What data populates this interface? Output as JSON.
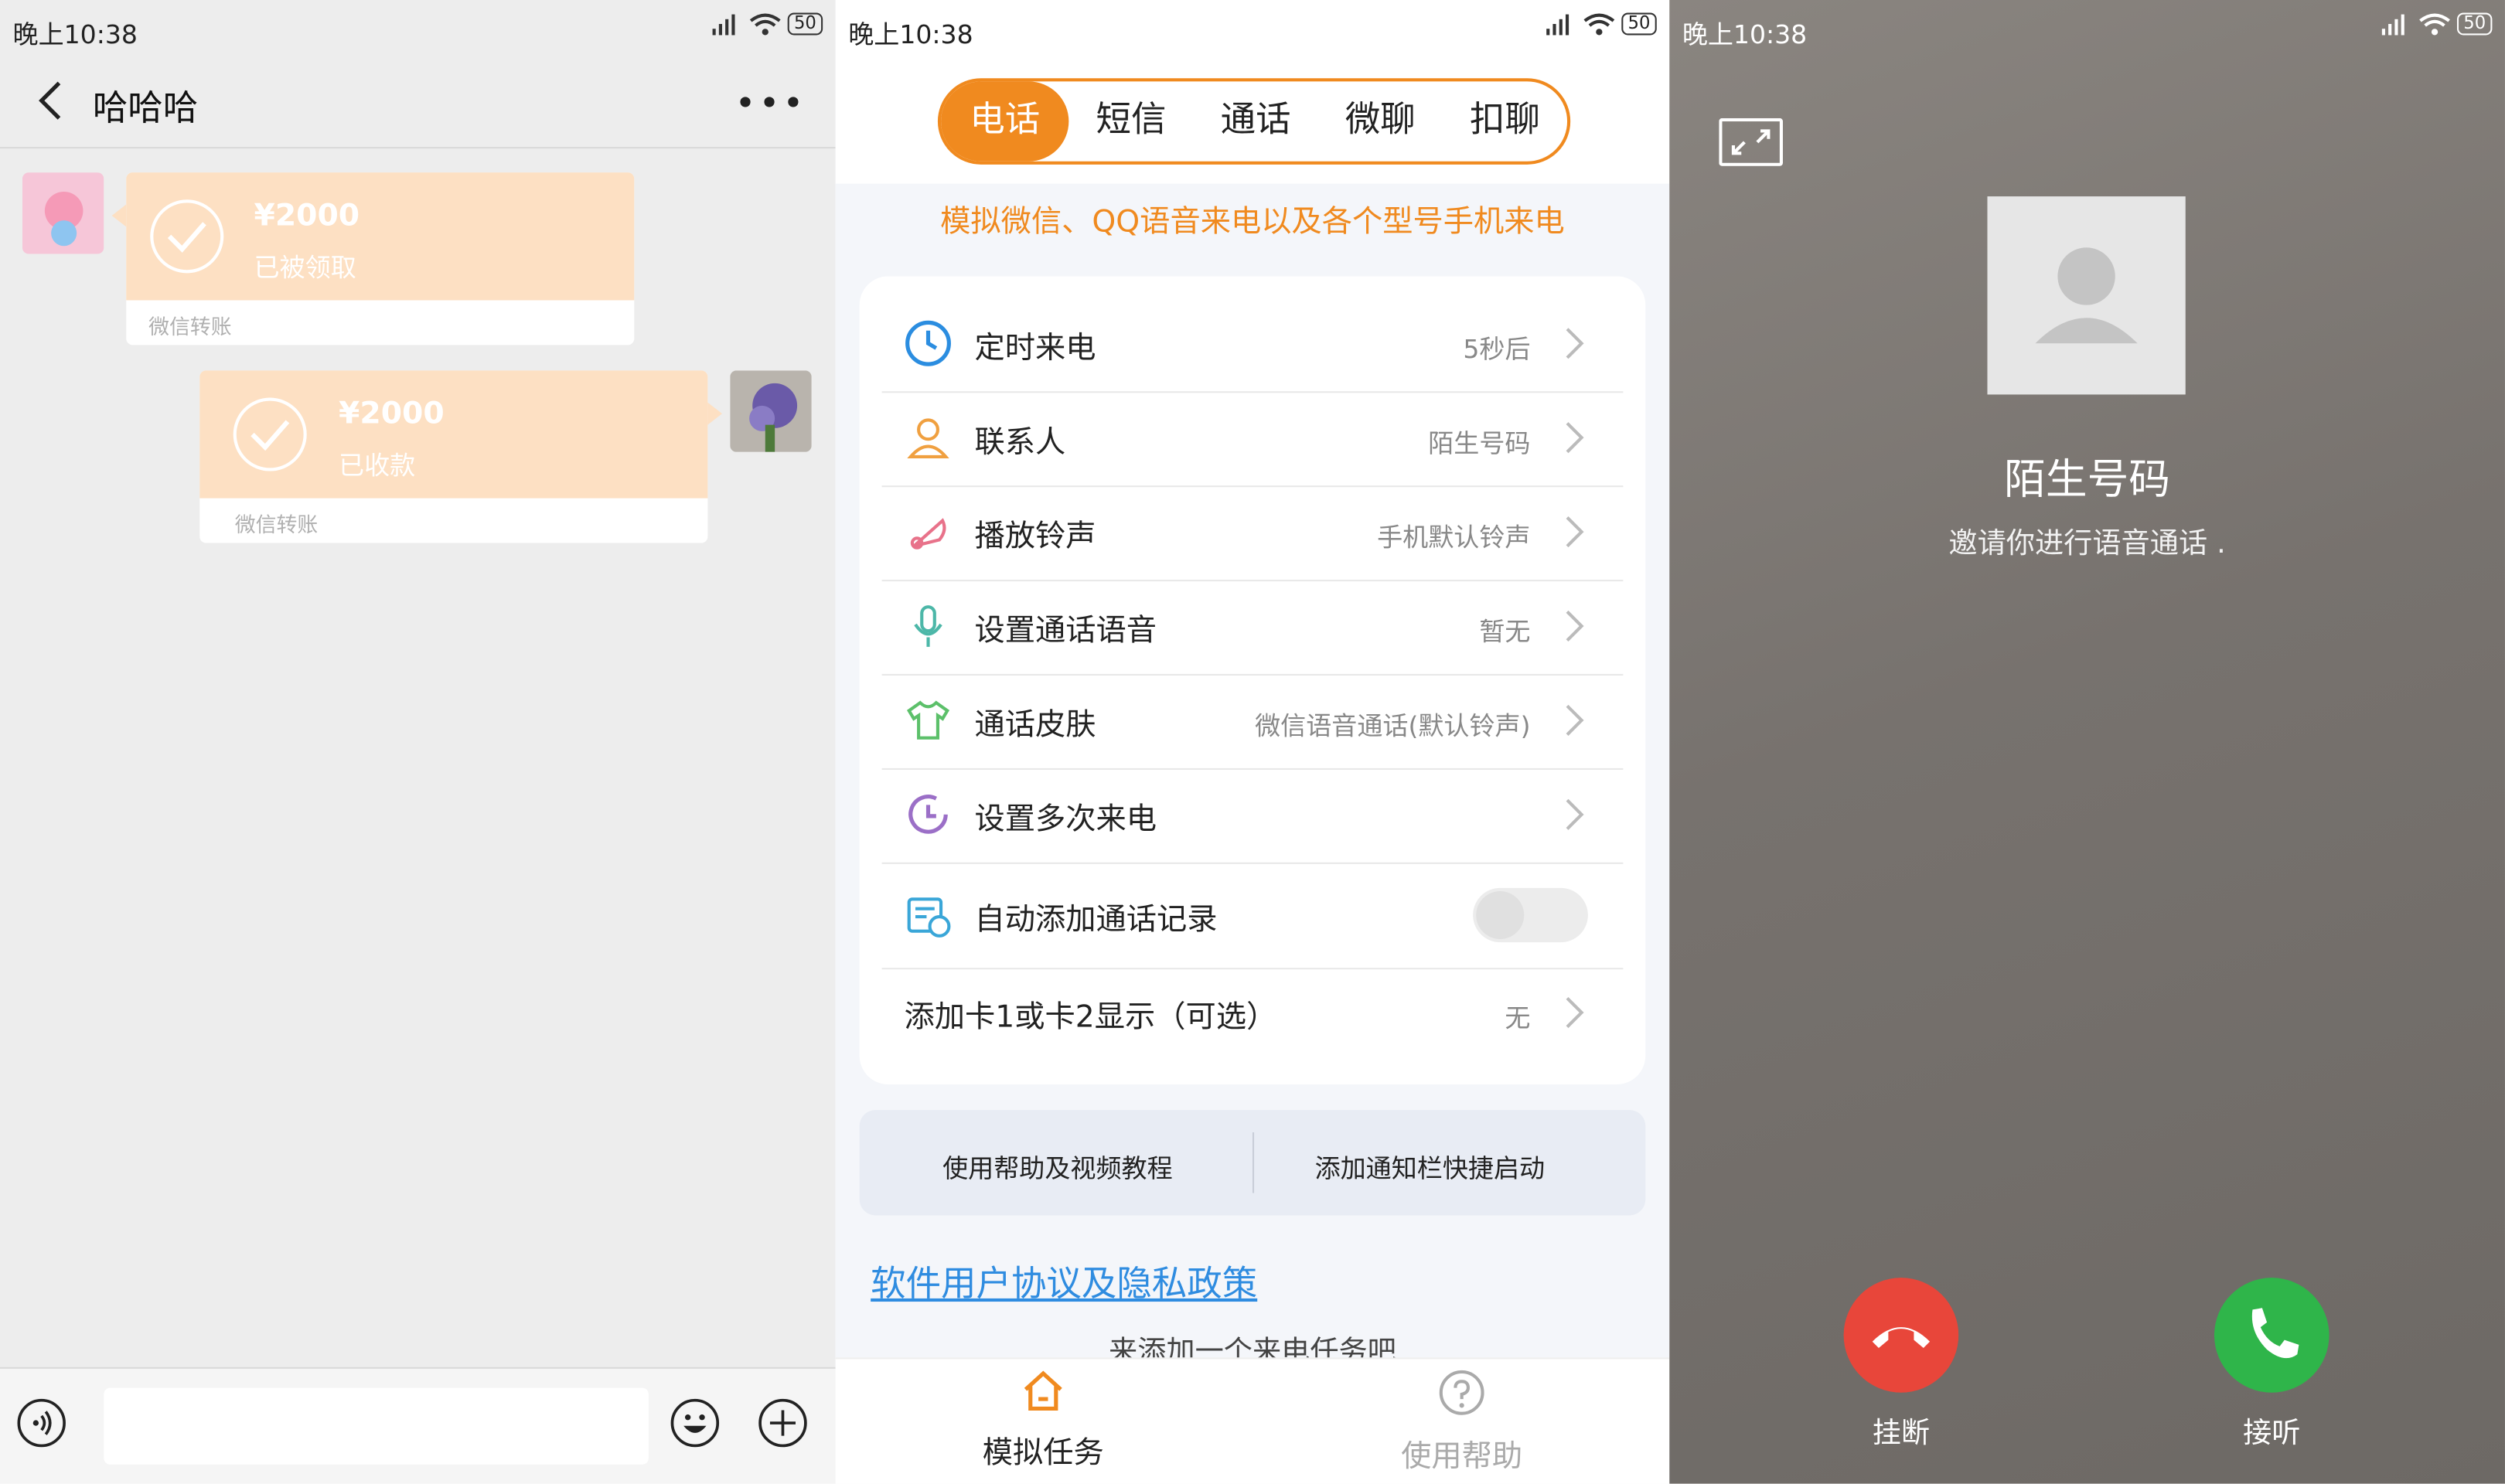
{
  "status_bar": {
    "time": "晚上10:38",
    "battery": "50"
  },
  "chat": {
    "title": "哈哈哈",
    "messages": [
      {
        "amount": "¥2000",
        "state": "已被领取",
        "footer": "微信转账"
      },
      {
        "amount": "¥2000",
        "state": "已收款",
        "footer": "微信转账"
      }
    ]
  },
  "settings": {
    "tabs": [
      "电话",
      "短信",
      "通话",
      "微聊",
      "扣聊"
    ],
    "notice": "模拟微信、QQ语音来电以及各个型号手机来电",
    "rows": [
      {
        "label": "定时来电",
        "value": "5秒后",
        "icon": "clock-icon"
      },
      {
        "label": "联系人",
        "value": "陌生号码",
        "icon": "person-icon"
      },
      {
        "label": "播放铃声",
        "value": "手机默认铃声",
        "icon": "bell-icon"
      },
      {
        "label": "设置通话语音",
        "value": "暂无",
        "icon": "microphone-icon"
      },
      {
        "label": "通话皮肤",
        "value": "微信语音通话(默认铃声)",
        "icon": "shirt-icon"
      },
      {
        "label": "设置多次来电",
        "value": "",
        "icon": "repeat-clock-icon"
      },
      {
        "label": "自动添加通话记录",
        "value": "",
        "icon": "calendar-icon"
      },
      {
        "label": "添加卡1或卡2显示（可选）",
        "value": "无"
      }
    ],
    "auto_log_enabled": false,
    "help_buttons": [
      "使用帮助及视频教程",
      "添加通知栏快捷启动"
    ],
    "policy_link": "软件用户协议及隐私政策",
    "hint": "来添加一个来电任务吧",
    "nav": [
      "模拟任务",
      "使用帮助"
    ],
    "colors": {
      "accent": "#f08a1f",
      "link": "#2f8ce0"
    }
  },
  "call": {
    "caller": "陌生号码",
    "subtitle": "邀请你进行语音通话 .",
    "decline": "挂断",
    "accept": "接听",
    "colors": {
      "decline": "#e8463a",
      "accept": "#2fb54a"
    }
  }
}
